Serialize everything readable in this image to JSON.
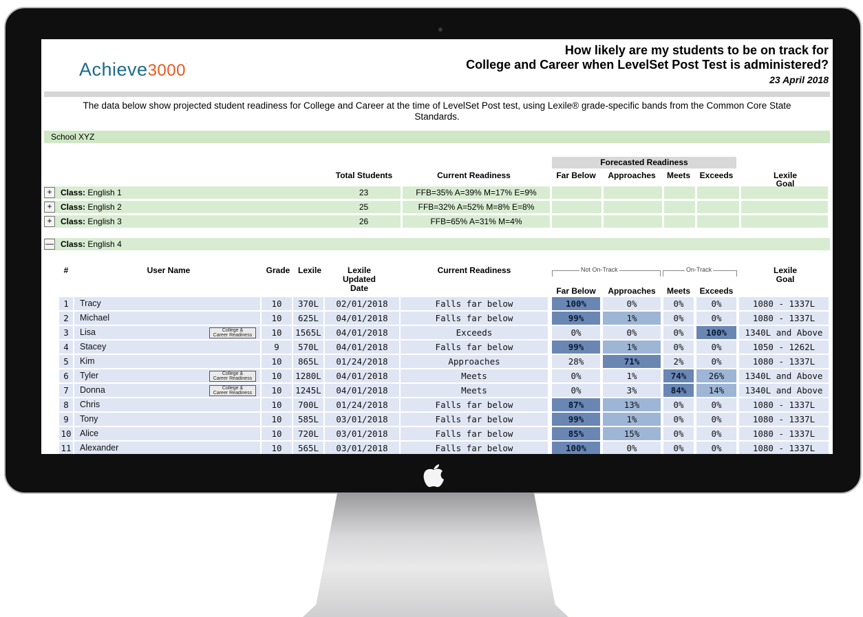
{
  "brand": {
    "name": "Achieve",
    "number": "3000",
    "mark": "."
  },
  "header": {
    "title_line1": "How likely are my students to be on track for",
    "title_line2": "College and Career when LevelSet Post Test is administered?",
    "date": "23 April 2018"
  },
  "description_line1": "The data below show projected student readiness for College and Career at the time of LevelSet Post test, using Lexile® grade-specific bands from the Common Core State",
  "description_line2": "Standards.",
  "school": "School XYZ",
  "summary_headers": {
    "forecasted": "Forecasted Readiness",
    "total_students": "Total Students",
    "current_readiness": "Current Readiness",
    "far_below": "Far Below",
    "approaches": "Approaches",
    "meets": "Meets",
    "exceeds": "Exceeds",
    "lexile_goal_1": "Lexile",
    "lexile_goal_2": "Goal"
  },
  "class_label": "Class:",
  "classes": [
    {
      "toggle": "+",
      "name": "English 1",
      "total": "23",
      "current": "FFB=35% A=39% M=17% E=9%"
    },
    {
      "toggle": "+",
      "name": "English 2",
      "total": "25",
      "current": "FFB=32% A=52% M=8% E=8%"
    },
    {
      "toggle": "+",
      "name": "English 3",
      "total": "26",
      "current": "FFB=65% A=31% M=4%"
    }
  ],
  "open_class": {
    "toggle": "—",
    "name": "English 4"
  },
  "student_headers": {
    "num": "#",
    "user": "User Name",
    "grade": "Grade",
    "lexile": "Lexile",
    "updated_1": "Lexile",
    "updated_2": "Updated",
    "updated_3": "Date",
    "current": "Current Readiness",
    "not_on_track": "Not On-Track",
    "on_track": "On-Track",
    "far_below": "Far Below",
    "approaches": "Approaches",
    "meets": "Meets",
    "exceeds": "Exceeds",
    "goal_1": "Lexile",
    "goal_2": "Goal"
  },
  "badge": {
    "line1": "College &",
    "line2": "Career Readiness"
  },
  "students": [
    {
      "n": "1",
      "name": "Tracy",
      "badge": false,
      "grade": "10",
      "lexile": "370L",
      "date": "02/01/2018",
      "current": "Falls far below",
      "fb": "100%",
      "ap": "0%",
      "me": "0%",
      "ex": "0%",
      "goal": "1080 - 1337L",
      "hl": "fb"
    },
    {
      "n": "2",
      "name": "Michael",
      "badge": false,
      "grade": "10",
      "lexile": "625L",
      "date": "04/01/2018",
      "current": "Falls far below",
      "fb": "99%",
      "ap": "1%",
      "me": "0%",
      "ex": "0%",
      "goal": "1080 - 1337L",
      "hl": "fb"
    },
    {
      "n": "3",
      "name": "Lisa",
      "badge": true,
      "grade": "10",
      "lexile": "1565L",
      "date": "04/01/2018",
      "current": "Exceeds",
      "fb": "0%",
      "ap": "0%",
      "me": "0%",
      "ex": "100%",
      "goal": "1340L and Above",
      "hl": "ex"
    },
    {
      "n": "4",
      "name": "Stacey",
      "badge": false,
      "grade": "9",
      "lexile": "570L",
      "date": "04/01/2018",
      "current": "Falls far below",
      "fb": "99%",
      "ap": "1%",
      "me": "0%",
      "ex": "0%",
      "goal": "1050 - 1262L",
      "hl": "fb"
    },
    {
      "n": "5",
      "name": "Kim",
      "badge": false,
      "grade": "10",
      "lexile": "865L",
      "date": "01/24/2018",
      "current": "Approaches",
      "fb": "28%",
      "ap": "71%",
      "me": "2%",
      "ex": "0%",
      "goal": "1080 - 1337L",
      "hl": "ap"
    },
    {
      "n": "6",
      "name": "Tyler",
      "badge": true,
      "grade": "10",
      "lexile": "1280L",
      "date": "04/01/2018",
      "current": "Meets",
      "fb": "0%",
      "ap": "1%",
      "me": "74%",
      "ex": "26%",
      "goal": "1340L and Above",
      "hl": "me"
    },
    {
      "n": "7",
      "name": "Donna",
      "badge": true,
      "grade": "10",
      "lexile": "1245L",
      "date": "04/01/2018",
      "current": "Meets",
      "fb": "0%",
      "ap": "3%",
      "me": "84%",
      "ex": "14%",
      "goal": "1340L and Above",
      "hl": "me"
    },
    {
      "n": "8",
      "name": "Chris",
      "badge": false,
      "grade": "10",
      "lexile": "700L",
      "date": "01/24/2018",
      "current": "Falls far below",
      "fb": "87%",
      "ap": "13%",
      "me": "0%",
      "ex": "0%",
      "goal": "1080 - 1337L",
      "hl": "fb"
    },
    {
      "n": "9",
      "name": "Tony",
      "badge": false,
      "grade": "10",
      "lexile": "585L",
      "date": "03/01/2018",
      "current": "Falls far below",
      "fb": "99%",
      "ap": "1%",
      "me": "0%",
      "ex": "0%",
      "goal": "1080 - 1337L",
      "hl": "fb"
    },
    {
      "n": "10",
      "name": "Alice",
      "badge": false,
      "grade": "10",
      "lexile": "720L",
      "date": "03/01/2018",
      "current": "Falls far below",
      "fb": "85%",
      "ap": "15%",
      "me": "0%",
      "ex": "0%",
      "goal": "1080 - 1337L",
      "hl": "fb"
    },
    {
      "n": "11",
      "name": "Alexander",
      "badge": false,
      "grade": "10",
      "lexile": "565L",
      "date": "03/01/2018",
      "current": "Falls far below",
      "fb": "100%",
      "ap": "0%",
      "me": "0%",
      "ex": "0%",
      "goal": "1080 - 1337L",
      "hl": "fb"
    }
  ]
}
